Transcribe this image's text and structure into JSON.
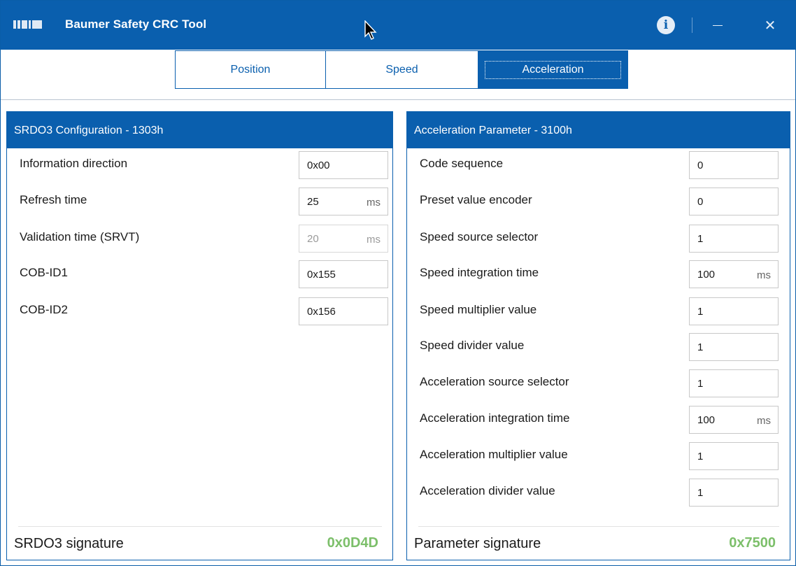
{
  "app": {
    "title": "Baumer Safety CRC Tool"
  },
  "titlebar": {
    "info_label": "i",
    "close_label": "✕"
  },
  "colors": {
    "accent": "#0a5fae",
    "signature": "#7cbf6a"
  },
  "tabs": [
    {
      "label": "Position",
      "active": false
    },
    {
      "label": "Speed",
      "active": false
    },
    {
      "label": "Acceleration",
      "active": true
    }
  ],
  "left_panel": {
    "title": "SRDO3 Configuration - 1303h",
    "rows": [
      {
        "label": "Information direction",
        "value": "0x00",
        "unit": ""
      },
      {
        "label": "Refresh time",
        "value": "25",
        "unit": "ms"
      },
      {
        "label": "Validation time (SRVT)",
        "value": "20",
        "unit": "ms",
        "disabled": true
      },
      {
        "label": "COB-ID1",
        "value": "0x155",
        "unit": ""
      },
      {
        "label": "COB-ID2",
        "value": "0x156",
        "unit": ""
      }
    ],
    "signature_label": "SRDO3 signature",
    "signature_value": "0x0D4D"
  },
  "right_panel": {
    "title": "Acceleration Parameter - 3100h",
    "rows": [
      {
        "label": "Code sequence",
        "value": "0",
        "unit": ""
      },
      {
        "label": "Preset value encoder",
        "value": "0",
        "unit": ""
      },
      {
        "label": "Speed source selector",
        "value": "1",
        "unit": ""
      },
      {
        "label": "Speed integration time",
        "value": "100",
        "unit": "ms"
      },
      {
        "label": "Speed multiplier value",
        "value": "1",
        "unit": ""
      },
      {
        "label": "Speed divider value",
        "value": "1",
        "unit": ""
      },
      {
        "label": "Acceleration source selector",
        "value": "1",
        "unit": ""
      },
      {
        "label": "Acceleration integration time",
        "value": "100",
        "unit": "ms"
      },
      {
        "label": "Acceleration multiplier value",
        "value": "1",
        "unit": ""
      },
      {
        "label": "Acceleration divider value",
        "value": "1",
        "unit": ""
      }
    ],
    "signature_label": "Parameter signature",
    "signature_value": "0x7500"
  }
}
